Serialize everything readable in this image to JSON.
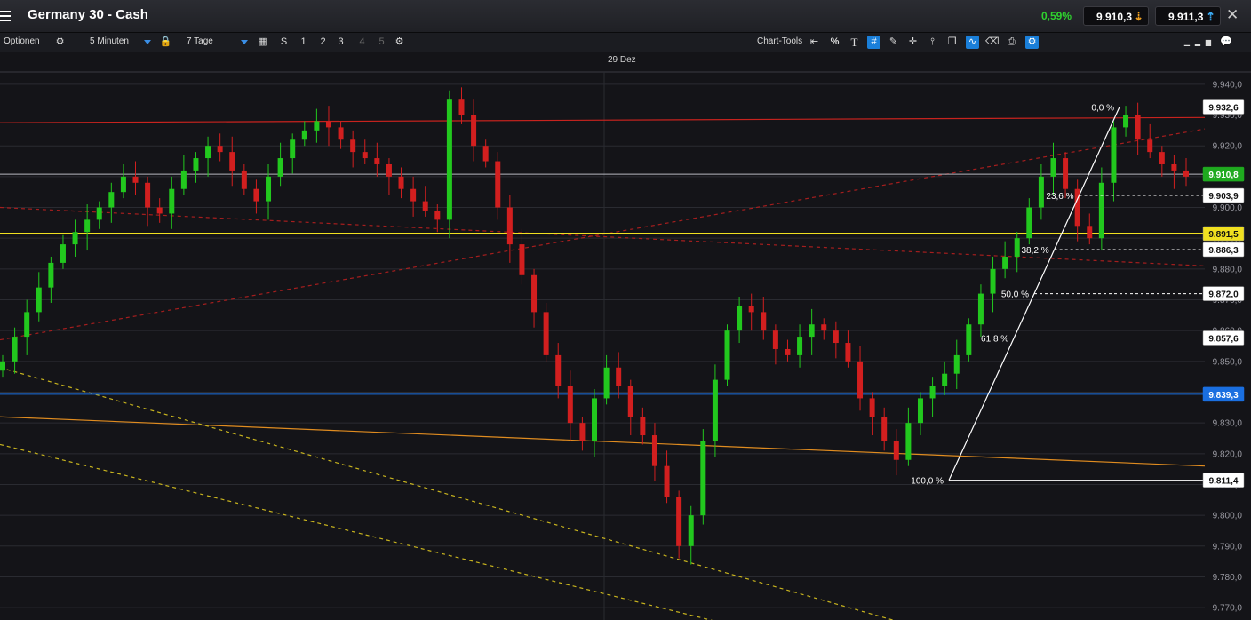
{
  "window": {
    "title": "Germany 30 - Cash",
    "change": "0,59%",
    "sell_price": "9.910,3",
    "buy_price": "9.911,3"
  },
  "toolbar": {
    "options_label": "Optionen",
    "interval": "5 Minuten",
    "range": "7 Tage",
    "chart_tools_label": "Chart-Tools",
    "s_label": "S",
    "l1": "1",
    "l2": "2",
    "l3": "3",
    "l4": "4",
    "l5": "5",
    "percent_label": "%",
    "text_tool_label": "T"
  },
  "chart_data": {
    "type": "candlestick",
    "instrument": "Germany 30 - Cash",
    "x_label_date": "29 Dez",
    "ylim": [
      9766,
      9944
    ],
    "y_ticks": [
      9770,
      9780,
      9790,
      9800,
      9810,
      9820,
      9830,
      9840,
      9850,
      9860,
      9870,
      9880,
      9890,
      9900,
      9910,
      9920,
      9930,
      9940
    ],
    "y_tick_labels": [
      "9.770,0",
      "9.780,0",
      "9.790,0",
      "9.800,0",
      "9.810,0",
      "9.820,0",
      "9.830,0",
      "9.840,0",
      "9.850,0",
      "9.860,0",
      "9.870,0",
      "9.880,0",
      "9.890,0",
      "9.900,0",
      "9.910,0",
      "9.920,0",
      "9.930,0",
      "9.940,0"
    ],
    "grid": true,
    "colors": {
      "up": "#22c81e",
      "down": "#d21f1f",
      "background": "#141418"
    },
    "close_series": [
      9850,
      9858,
      9866,
      9874,
      9882,
      9888,
      9892,
      9896,
      9900,
      9905,
      9910,
      9908,
      9900,
      9898,
      9906,
      9912,
      9916,
      9920,
      9918,
      9912,
      9906,
      9902,
      9910,
      9916,
      9922,
      9925,
      9928,
      9926,
      9922,
      9918,
      9916,
      9914,
      9910,
      9906,
      9902,
      9899,
      9896,
      9935,
      9930,
      9920,
      9915,
      9900,
      9888,
      9878,
      9866,
      9852,
      9842,
      9830,
      9824,
      9838,
      9848,
      9842,
      9832,
      9826,
      9816,
      9806,
      9790,
      9800,
      9824,
      9844,
      9860,
      9868,
      9866,
      9860,
      9854,
      9852,
      9858,
      9862,
      9860,
      9856,
      9850,
      9838,
      9832,
      9824,
      9818,
      9830,
      9838,
      9842,
      9846,
      9852,
      9862,
      9872,
      9880,
      9884,
      9890,
      9900,
      9910,
      9916,
      9906,
      9894,
      9890,
      9908,
      9926,
      9930,
      9922,
      9918,
      9914,
      9912,
      9910
    ],
    "price_labels": [
      {
        "label": "9.932,6",
        "value": 9932.6,
        "color": "#ffffff"
      },
      {
        "label": "9.910,8",
        "value": 9910.8,
        "color": "#1faa1f"
      },
      {
        "label": "9.903,9",
        "value": 9903.9,
        "color": "#ffffff"
      },
      {
        "label": "9.891,5",
        "value": 9891.5,
        "color": "#f0e020"
      },
      {
        "label": "9.886,3",
        "value": 9886.3,
        "color": "#ffffff"
      },
      {
        "label": "9.872,0",
        "value": 9872.0,
        "color": "#ffffff"
      },
      {
        "label": "9.857,6",
        "value": 9857.6,
        "color": "#ffffff"
      },
      {
        "label": "9.839,3",
        "value": 9839.3,
        "color": "#1a6fe0"
      },
      {
        "label": "9.811,4",
        "value": 9811.4,
        "color": "#ffffff"
      }
    ],
    "fibonacci": {
      "high": 9932.6,
      "low": 9811.4,
      "levels": [
        {
          "label": "0,0 %",
          "value": 9932.6
        },
        {
          "label": "23,6 %",
          "value": 9903.9
        },
        {
          "label": "38,2 %",
          "value": 9886.3
        },
        {
          "label": "50,0 %",
          "value": 9872.0
        },
        {
          "label": "61,8 %",
          "value": 9857.6
        },
        {
          "label": "100,0 %",
          "value": 9811.4
        }
      ]
    },
    "horizontal_lines": [
      {
        "value": 9910.8,
        "color": "#b8b8c0"
      },
      {
        "value": 9891.5,
        "color": "#f0e020"
      },
      {
        "value": 9839.3,
        "color": "#1a6fe0"
      }
    ],
    "trend_lines": [
      {
        "from": [
          0,
          9927.5
        ],
        "to": [
          1,
          9929.2
        ],
        "color": "#c8231e",
        "style": "solid"
      },
      {
        "from": [
          0,
          9857.0
        ],
        "to": [
          1,
          9925.5
        ],
        "color": "#a51e1e",
        "style": "dashed"
      },
      {
        "from": [
          0,
          9900.0
        ],
        "to": [
          1,
          9881.0
        ],
        "color": "#a51e1e",
        "style": "dashed"
      },
      {
        "from": [
          0,
          9832.0
        ],
        "to": [
          1,
          9816.0
        ],
        "color": "#e08c20",
        "style": "solid"
      },
      {
        "from": [
          0,
          9848.0
        ],
        "to": [
          0.75,
          9765.0
        ],
        "color": "#c8b41e",
        "style": "dashed"
      },
      {
        "from": [
          0,
          9823.0
        ],
        "to": [
          0.6,
          9765.0
        ],
        "color": "#c8b41e",
        "style": "dashed"
      }
    ]
  }
}
